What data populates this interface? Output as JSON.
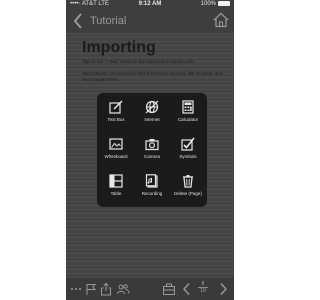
{
  "status_bar": {
    "carrier": "••••◦ AT&T  LTE",
    "time": "9:12 AM",
    "battery": "100%"
  },
  "nav": {
    "title": "Tutorial"
  },
  "page": {
    "title": "Importing",
    "paragraph1": "Tap on the \"+ Box\" button in the lower left to import a file.",
    "paragraph2": "SketchNotes can download files from many sources, like Dropbox, Box and Google Drive."
  },
  "menu": {
    "items": [
      {
        "label": "Text Box",
        "icon": "text-box-icon"
      },
      {
        "label": "Internet",
        "icon": "internet-icon"
      },
      {
        "label": "Calculator",
        "icon": "calculator-icon"
      },
      {
        "label": "Whiteboard",
        "icon": "whiteboard-icon"
      },
      {
        "label": "Camera",
        "icon": "camera-icon"
      },
      {
        "label": "Symbols",
        "icon": "symbols-icon"
      },
      {
        "label": "Table",
        "icon": "table-icon"
      },
      {
        "label": "Recording",
        "icon": "recording-icon"
      },
      {
        "label": "Delete (Page)",
        "icon": "trash-icon"
      }
    ]
  },
  "toolbar": {
    "page_current": "8",
    "page_total": "10"
  },
  "colors": {
    "screen_bg": "#444444",
    "menu_bg": "#1b1b1b",
    "icon": "#e8e8e8"
  }
}
